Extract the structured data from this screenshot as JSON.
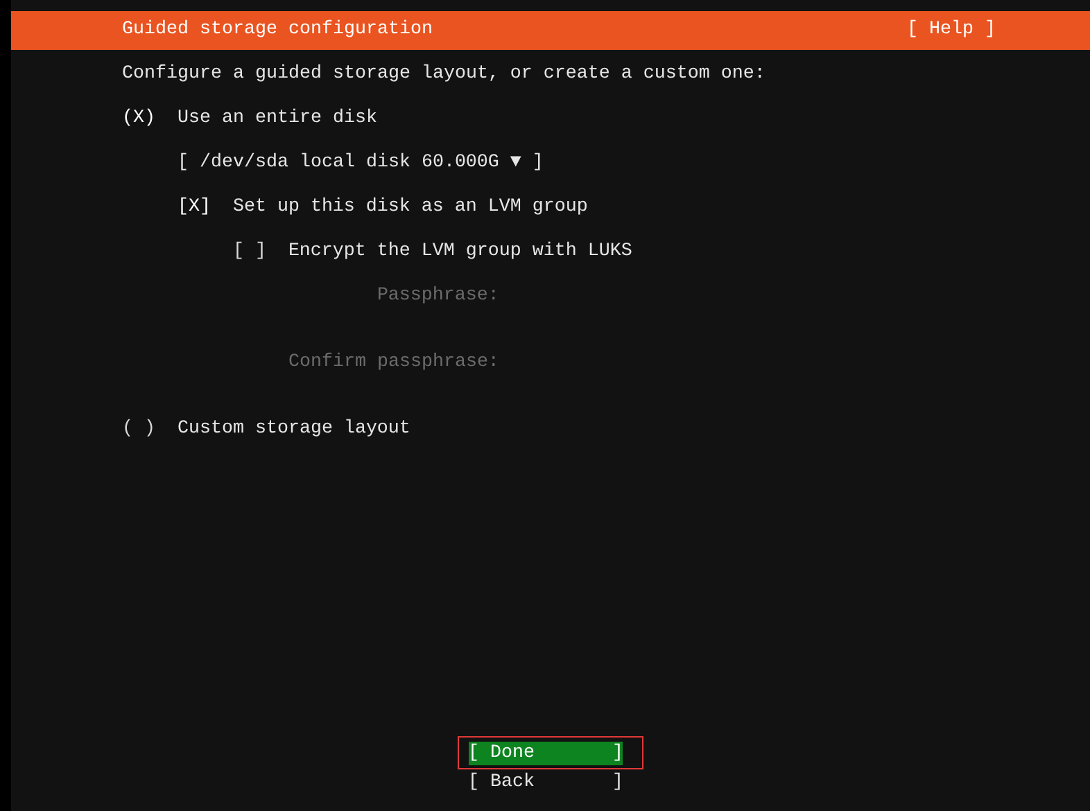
{
  "header": {
    "title": "Guided storage configuration",
    "help": "[ Help ]"
  },
  "intro": "Configure a guided storage layout, or create a custom one:",
  "options": [
    {
      "kind": "radio",
      "selected": true,
      "mark": "(X)",
      "label": "Use an entire disk",
      "children": [
        {
          "kind": "dropdown",
          "value": "[ /dev/sda local disk 60.000G ▼ ]"
        },
        {
          "kind": "checkbox",
          "checked": true,
          "mark": "[X]",
          "label": "Set up this disk as an LVM group",
          "children": [
            {
              "kind": "checkbox",
              "checked": false,
              "mark": "[ ]",
              "label": "Encrypt the LVM group with LUKS",
              "children": [
                {
                  "kind": "field",
                  "label": "Passphrase:",
                  "disabled": true
                },
                {
                  "kind": "field",
                  "label": "Confirm passphrase:",
                  "disabled": true
                }
              ]
            }
          ]
        }
      ]
    },
    {
      "kind": "radio",
      "selected": false,
      "mark": "( )",
      "label": "Custom storage layout"
    }
  ],
  "buttons": [
    {
      "label": "[ Done       ]",
      "selected": true,
      "outlined": true
    },
    {
      "label": "[ Back       ]",
      "selected": false,
      "outlined": false
    }
  ]
}
